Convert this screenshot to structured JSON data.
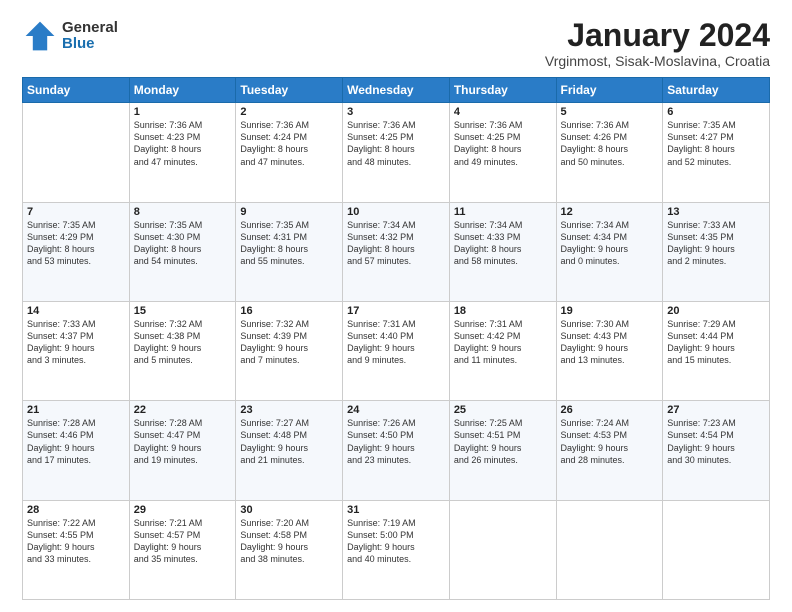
{
  "header": {
    "logo": {
      "general": "General",
      "blue": "Blue"
    },
    "title": "January 2024",
    "subtitle": "Vrginmost, Sisak-Moslavina, Croatia"
  },
  "days_of_week": [
    "Sunday",
    "Monday",
    "Tuesday",
    "Wednesday",
    "Thursday",
    "Friday",
    "Saturday"
  ],
  "weeks": [
    [
      {
        "num": "",
        "info": ""
      },
      {
        "num": "1",
        "info": "Sunrise: 7:36 AM\nSunset: 4:23 PM\nDaylight: 8 hours\nand 47 minutes."
      },
      {
        "num": "2",
        "info": "Sunrise: 7:36 AM\nSunset: 4:24 PM\nDaylight: 8 hours\nand 47 minutes."
      },
      {
        "num": "3",
        "info": "Sunrise: 7:36 AM\nSunset: 4:25 PM\nDaylight: 8 hours\nand 48 minutes."
      },
      {
        "num": "4",
        "info": "Sunrise: 7:36 AM\nSunset: 4:25 PM\nDaylight: 8 hours\nand 49 minutes."
      },
      {
        "num": "5",
        "info": "Sunrise: 7:36 AM\nSunset: 4:26 PM\nDaylight: 8 hours\nand 50 minutes."
      },
      {
        "num": "6",
        "info": "Sunrise: 7:35 AM\nSunset: 4:27 PM\nDaylight: 8 hours\nand 52 minutes."
      }
    ],
    [
      {
        "num": "7",
        "info": "Sunrise: 7:35 AM\nSunset: 4:29 PM\nDaylight: 8 hours\nand 53 minutes."
      },
      {
        "num": "8",
        "info": "Sunrise: 7:35 AM\nSunset: 4:30 PM\nDaylight: 8 hours\nand 54 minutes."
      },
      {
        "num": "9",
        "info": "Sunrise: 7:35 AM\nSunset: 4:31 PM\nDaylight: 8 hours\nand 55 minutes."
      },
      {
        "num": "10",
        "info": "Sunrise: 7:34 AM\nSunset: 4:32 PM\nDaylight: 8 hours\nand 57 minutes."
      },
      {
        "num": "11",
        "info": "Sunrise: 7:34 AM\nSunset: 4:33 PM\nDaylight: 8 hours\nand 58 minutes."
      },
      {
        "num": "12",
        "info": "Sunrise: 7:34 AM\nSunset: 4:34 PM\nDaylight: 9 hours\nand 0 minutes."
      },
      {
        "num": "13",
        "info": "Sunrise: 7:33 AM\nSunset: 4:35 PM\nDaylight: 9 hours\nand 2 minutes."
      }
    ],
    [
      {
        "num": "14",
        "info": "Sunrise: 7:33 AM\nSunset: 4:37 PM\nDaylight: 9 hours\nand 3 minutes."
      },
      {
        "num": "15",
        "info": "Sunrise: 7:32 AM\nSunset: 4:38 PM\nDaylight: 9 hours\nand 5 minutes."
      },
      {
        "num": "16",
        "info": "Sunrise: 7:32 AM\nSunset: 4:39 PM\nDaylight: 9 hours\nand 7 minutes."
      },
      {
        "num": "17",
        "info": "Sunrise: 7:31 AM\nSunset: 4:40 PM\nDaylight: 9 hours\nand 9 minutes."
      },
      {
        "num": "18",
        "info": "Sunrise: 7:31 AM\nSunset: 4:42 PM\nDaylight: 9 hours\nand 11 minutes."
      },
      {
        "num": "19",
        "info": "Sunrise: 7:30 AM\nSunset: 4:43 PM\nDaylight: 9 hours\nand 13 minutes."
      },
      {
        "num": "20",
        "info": "Sunrise: 7:29 AM\nSunset: 4:44 PM\nDaylight: 9 hours\nand 15 minutes."
      }
    ],
    [
      {
        "num": "21",
        "info": "Sunrise: 7:28 AM\nSunset: 4:46 PM\nDaylight: 9 hours\nand 17 minutes."
      },
      {
        "num": "22",
        "info": "Sunrise: 7:28 AM\nSunset: 4:47 PM\nDaylight: 9 hours\nand 19 minutes."
      },
      {
        "num": "23",
        "info": "Sunrise: 7:27 AM\nSunset: 4:48 PM\nDaylight: 9 hours\nand 21 minutes."
      },
      {
        "num": "24",
        "info": "Sunrise: 7:26 AM\nSunset: 4:50 PM\nDaylight: 9 hours\nand 23 minutes."
      },
      {
        "num": "25",
        "info": "Sunrise: 7:25 AM\nSunset: 4:51 PM\nDaylight: 9 hours\nand 26 minutes."
      },
      {
        "num": "26",
        "info": "Sunrise: 7:24 AM\nSunset: 4:53 PM\nDaylight: 9 hours\nand 28 minutes."
      },
      {
        "num": "27",
        "info": "Sunrise: 7:23 AM\nSunset: 4:54 PM\nDaylight: 9 hours\nand 30 minutes."
      }
    ],
    [
      {
        "num": "28",
        "info": "Sunrise: 7:22 AM\nSunset: 4:55 PM\nDaylight: 9 hours\nand 33 minutes."
      },
      {
        "num": "29",
        "info": "Sunrise: 7:21 AM\nSunset: 4:57 PM\nDaylight: 9 hours\nand 35 minutes."
      },
      {
        "num": "30",
        "info": "Sunrise: 7:20 AM\nSunset: 4:58 PM\nDaylight: 9 hours\nand 38 minutes."
      },
      {
        "num": "31",
        "info": "Sunrise: 7:19 AM\nSunset: 5:00 PM\nDaylight: 9 hours\nand 40 minutes."
      },
      {
        "num": "",
        "info": ""
      },
      {
        "num": "",
        "info": ""
      },
      {
        "num": "",
        "info": ""
      }
    ]
  ]
}
